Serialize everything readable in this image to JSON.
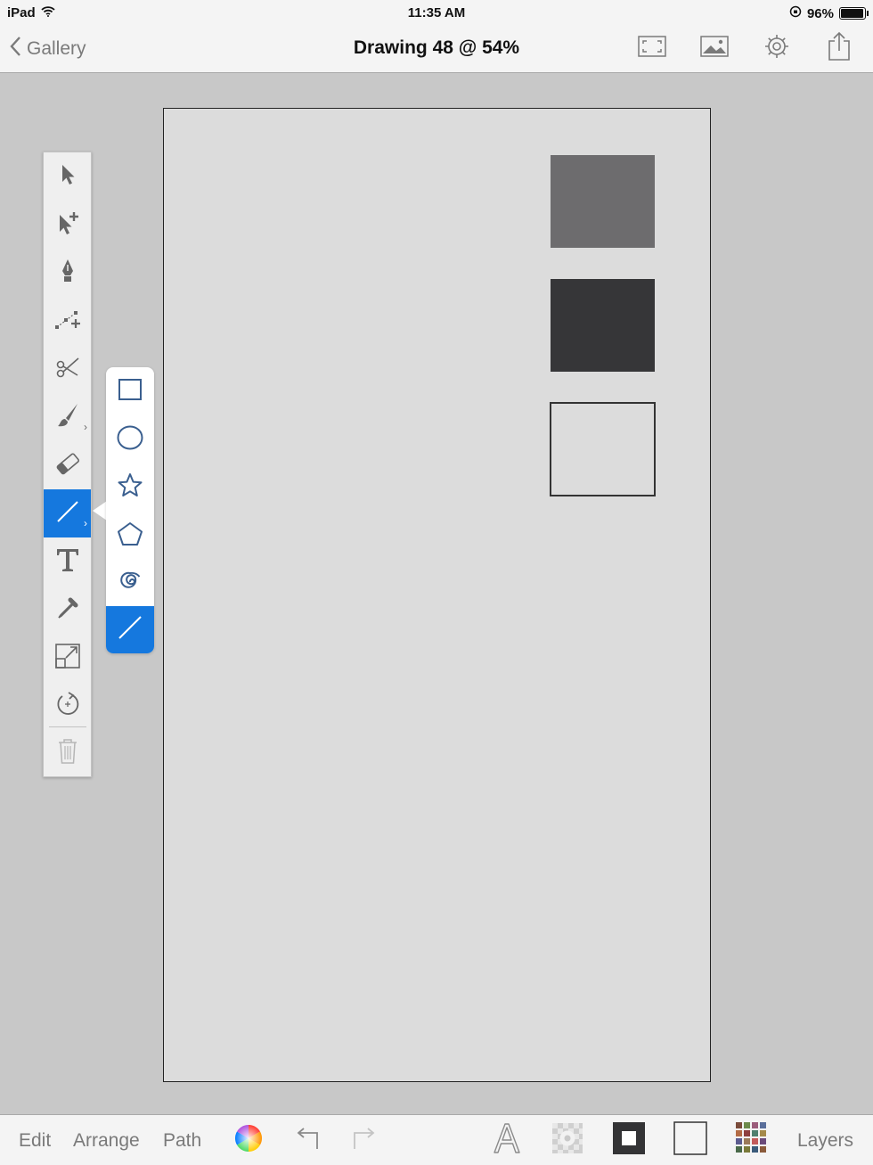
{
  "status_bar": {
    "device": "iPad",
    "time": "11:35 AM",
    "battery": "96%",
    "battery_level": 0.96
  },
  "navbar": {
    "back_label": "Gallery",
    "title": "Drawing 48 @ 54%",
    "icons": [
      "fullscreen-icon",
      "image-icon",
      "settings-icon",
      "share-icon"
    ]
  },
  "canvas": {
    "background": "#dcdcdc",
    "shapes": [
      {
        "type": "rectangle",
        "fill": "#6d6c6e"
      },
      {
        "type": "rectangle",
        "fill": "#363638"
      },
      {
        "type": "rectangle",
        "fill": "none",
        "stroke": "#333333"
      }
    ]
  },
  "tools": [
    {
      "name": "select",
      "icon": "arrow-icon"
    },
    {
      "name": "direct-select",
      "icon": "arrow-plus-icon"
    },
    {
      "name": "pen",
      "icon": "pen-nib-icon"
    },
    {
      "name": "add-point",
      "icon": "add-point-icon"
    },
    {
      "name": "scissors",
      "icon": "scissors-icon"
    },
    {
      "name": "brush",
      "icon": "brush-icon",
      "submenu": true
    },
    {
      "name": "eraser",
      "icon": "eraser-icon"
    },
    {
      "name": "line",
      "icon": "line-icon",
      "submenu": true,
      "active": true
    },
    {
      "name": "text",
      "icon": "text-icon"
    },
    {
      "name": "eyedropper",
      "icon": "eyedropper-icon"
    },
    {
      "name": "scale",
      "icon": "scale-icon"
    },
    {
      "name": "rotate",
      "icon": "rotate-icon"
    },
    {
      "name": "delete",
      "icon": "trash-icon"
    }
  ],
  "shape_popover": {
    "items": [
      "rectangle-icon",
      "ellipse-icon",
      "star-icon",
      "pentagon-icon",
      "spiral-icon",
      "line-icon"
    ],
    "selected": "line-icon"
  },
  "bottom_bar": {
    "edit_label": "Edit",
    "arrange_label": "Arrange",
    "path_label": "Path",
    "layers_label": "Layers",
    "icons": [
      "color-wheel-icon",
      "undo-icon",
      "redo-icon",
      "font-icon",
      "shadow-icon",
      "stroke-swatch-icon",
      "fill-swatch-icon",
      "swatches-icon"
    ]
  },
  "colors": {
    "accent": "#1578de",
    "bar_background": "#f4f4f4",
    "workspace": "#c8c8c8",
    "muted_text": "#7a7a7a"
  }
}
